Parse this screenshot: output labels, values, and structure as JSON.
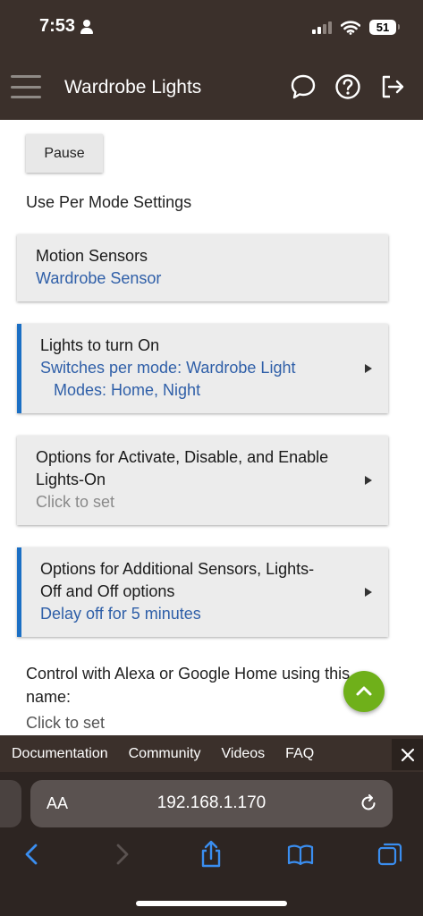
{
  "status_bar": {
    "time": "7:53",
    "battery": "51"
  },
  "app_bar": {
    "title": "Wardrobe Lights"
  },
  "content": {
    "pause_label": "Pause",
    "per_mode_label": "Use Per Mode Settings",
    "cards": [
      {
        "title": "Motion Sensors",
        "value": "Wardrobe Sensor"
      },
      {
        "title": "Lights to turn On",
        "value_line1": "Switches per mode: Wardrobe Light",
        "value_line2": "Modes: Home, Night"
      },
      {
        "title_line1": "Options for Activate, Disable, and Enable",
        "title_line2": "Lights-On",
        "value": "Click to set"
      },
      {
        "title_line1": "Options for Additional Sensors, Lights-",
        "title_line2": "Off and Off options",
        "value": "Delay off for 5 minutes"
      }
    ],
    "alexa_label": "Control with Alexa or Google Home using this name:",
    "alexa_value": "Click to set"
  },
  "footer_nav": {
    "links": [
      "Documentation",
      "Community",
      "Videos",
      "FAQ"
    ]
  },
  "browser": {
    "url": "192.168.1.170",
    "text_size_label": "AA"
  },
  "colors": {
    "header": "#3b302b",
    "accent": "#1b6fc4",
    "link": "#2f5fa8",
    "fab": "#6fb01a"
  },
  "icons": [
    "person-icon",
    "signal-icon",
    "wifi-icon",
    "battery-icon",
    "menu-icon",
    "chat-icon",
    "help-icon",
    "logout-icon",
    "chevron-right-icon",
    "chevron-up-icon",
    "close-icon",
    "reload-icon",
    "back-icon",
    "forward-icon",
    "share-icon",
    "bookmarks-icon",
    "tabs-icon"
  ]
}
